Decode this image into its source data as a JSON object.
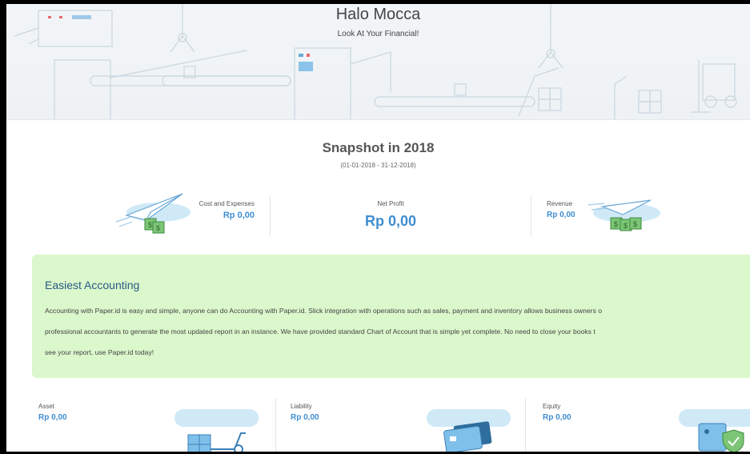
{
  "header": {
    "greeting": "Halo Mocca",
    "subtitle": "Look At Your Financial!"
  },
  "snapshot": {
    "title": "Snapshot in 2018",
    "range": "(01-01-2018 - 31-12-2018)",
    "cost": {
      "label": "Cost and Expenses",
      "value": "Rp 0,00"
    },
    "profit": {
      "label": "Net Profit",
      "value": "Rp 0,00"
    },
    "revenue": {
      "label": "Revenue",
      "value": "Rp 0,00"
    }
  },
  "info_card": {
    "title": "Easiest Accounting",
    "lines": [
      "Accounting with Paper.id is easy and simple, anyone can do Accounting with Paper.id. Slick integration with operations such as sales, payment and inventory allows business owners o",
      "professional accountants to generate the most updated report in an instance. We have provided standard Chart of Account that is simple yet complete. No need to close your books t",
      "see your report, use Paper.id today!"
    ]
  },
  "balance": {
    "asset": {
      "label": "Asset",
      "value": "Rp 0,00"
    },
    "liability": {
      "label": "Liability",
      "value": "Rp 0,00"
    },
    "equity": {
      "label": "Equity",
      "value": "Rp 0,00"
    }
  },
  "colors": {
    "accent": "#3f8ed0",
    "card_bg": "#dbf7cc",
    "card_title": "#2a5b84",
    "illustration": "#9fd2ee"
  },
  "icons": [
    "paper-plane-money-icon",
    "scooter-boxes-icon",
    "credit-cards-icon",
    "wallet-shield-icon"
  ]
}
